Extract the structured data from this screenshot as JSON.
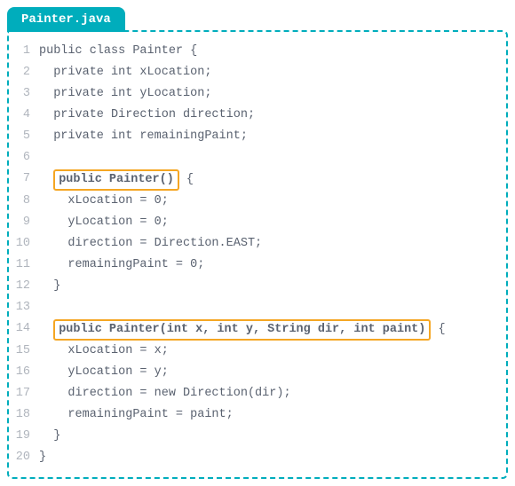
{
  "file_tab": "Painter.java",
  "colors": {
    "accent": "#00adbc",
    "highlight_border": "#f5a623",
    "gutter": "#b0b5bd",
    "text": "#5a6270"
  },
  "lines": [
    {
      "n": "1",
      "indent": 0,
      "text": "public class Painter {",
      "highlight": null,
      "after": null
    },
    {
      "n": "2",
      "indent": 1,
      "text": "private int xLocation;",
      "highlight": null,
      "after": null
    },
    {
      "n": "3",
      "indent": 1,
      "text": "private int yLocation;",
      "highlight": null,
      "after": null
    },
    {
      "n": "4",
      "indent": 1,
      "text": "private Direction direction;",
      "highlight": null,
      "after": null
    },
    {
      "n": "5",
      "indent": 1,
      "text": "private int remainingPaint;",
      "highlight": null,
      "after": null
    },
    {
      "n": "6",
      "indent": 0,
      "text": "",
      "highlight": null,
      "after": null
    },
    {
      "n": "7",
      "indent": 1,
      "text": null,
      "highlight": "public Painter()",
      "after": " {"
    },
    {
      "n": "8",
      "indent": 2,
      "text": "xLocation = 0;",
      "highlight": null,
      "after": null
    },
    {
      "n": "9",
      "indent": 2,
      "text": "yLocation = 0;",
      "highlight": null,
      "after": null
    },
    {
      "n": "10",
      "indent": 2,
      "text": "direction = Direction.EAST;",
      "highlight": null,
      "after": null
    },
    {
      "n": "11",
      "indent": 2,
      "text": "remainingPaint = 0;",
      "highlight": null,
      "after": null
    },
    {
      "n": "12",
      "indent": 1,
      "text": "}",
      "highlight": null,
      "after": null
    },
    {
      "n": "13",
      "indent": 0,
      "text": "",
      "highlight": null,
      "after": null
    },
    {
      "n": "14",
      "indent": 1,
      "text": null,
      "highlight": "public Painter(int x, int y, String dir, int paint)",
      "after": " {"
    },
    {
      "n": "15",
      "indent": 2,
      "text": "xLocation = x;",
      "highlight": null,
      "after": null
    },
    {
      "n": "16",
      "indent": 2,
      "text": "yLocation = y;",
      "highlight": null,
      "after": null
    },
    {
      "n": "17",
      "indent": 2,
      "text": "direction = new Direction(dir);",
      "highlight": null,
      "after": null
    },
    {
      "n": "18",
      "indent": 2,
      "text": "remainingPaint = paint;",
      "highlight": null,
      "after": null
    },
    {
      "n": "19",
      "indent": 1,
      "text": "}",
      "highlight": null,
      "after": null
    },
    {
      "n": "20",
      "indent": 0,
      "text": "}",
      "highlight": null,
      "after": null
    }
  ]
}
